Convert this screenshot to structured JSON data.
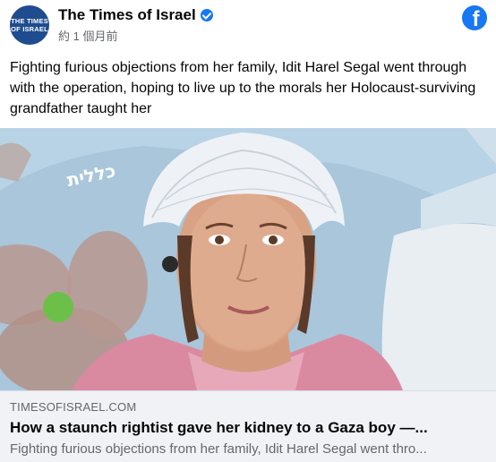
{
  "header": {
    "avatar_line1": "THE TIMES",
    "avatar_line2": "OF ISRAEL",
    "page_name": "The Times of Israel",
    "post_time": "約 1 個月前"
  },
  "post": {
    "message": "Fighting furious objections from her family, Idit Harel Segal went through with the operation, hoping to live up to the morals her Holocaust-surviving grandfather taught her"
  },
  "photo": {
    "pillow_logo": "כללית"
  },
  "link": {
    "domain": "TIMESOFISRAEL.COM",
    "title": "How a staunch rightist gave her kidney to a Gaza boy —...",
    "description": "Fighting furious objections from her family, Idit Harel Segal went thro..."
  },
  "colors": {
    "facebook_blue": "#1877f2",
    "verified_badge": "#1877f2",
    "avatar_bg": "#1f4c8f",
    "link_box_bg": "#f0f2f5",
    "secondary_text": "#65676b"
  },
  "icons": [
    "facebook-icon",
    "verified-badge-icon"
  ]
}
